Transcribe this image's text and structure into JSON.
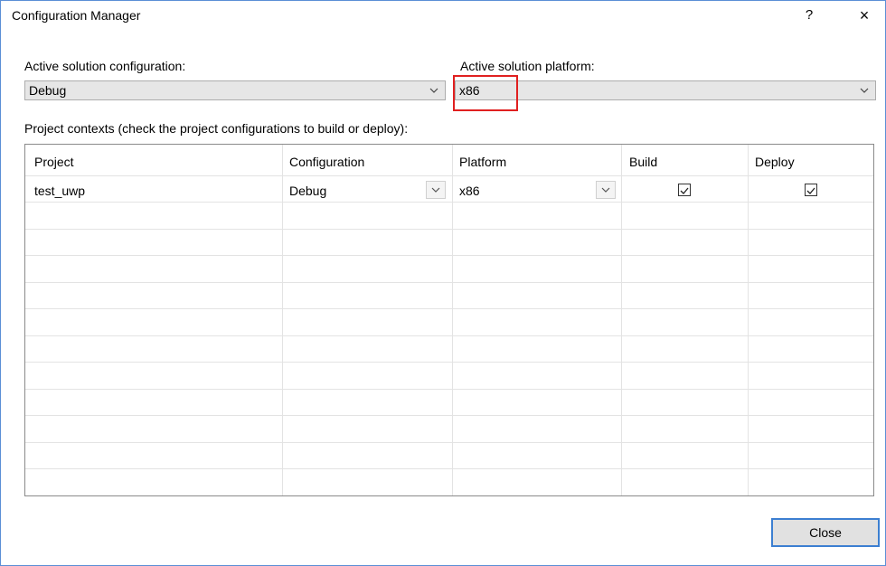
{
  "window": {
    "title": "Configuration Manager",
    "help_label": "?",
    "close_glyph": "×"
  },
  "active_config": {
    "label": "Active solution configuration:",
    "value": "Debug"
  },
  "active_platform": {
    "label": "Active solution platform:",
    "value": "x86"
  },
  "contexts_label": "Project contexts (check the project configurations to build or deploy):",
  "table": {
    "headers": [
      "Project",
      "Configuration",
      "Platform",
      "Build",
      "Deploy"
    ],
    "rows": [
      {
        "project": "test_uwp",
        "configuration": "Debug",
        "platform": "x86",
        "build": true,
        "deploy": true
      }
    ]
  },
  "footer": {
    "close_label": "Close"
  },
  "colors": {
    "highlight": "#e02020",
    "accent": "#3c7fd1"
  }
}
